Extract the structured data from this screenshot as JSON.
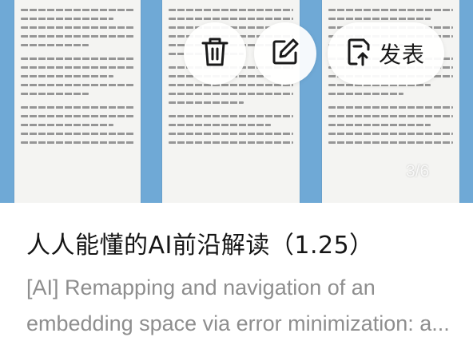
{
  "preview": {
    "pages_label": "3/6"
  },
  "actions": {
    "delete_icon": "trash-icon",
    "edit_icon": "edit-icon",
    "publish_icon": "publish-icon",
    "publish_label": "发表"
  },
  "note": {
    "title": "人人能懂的AI前沿解读（1.25）",
    "summary": "[AI] Remapping and navigation of an embedding space via error minimization: a..."
  },
  "colors": {
    "preview_background": "#6fa9d6",
    "title_text": "#151515",
    "summary_text": "#8e8e8e"
  }
}
